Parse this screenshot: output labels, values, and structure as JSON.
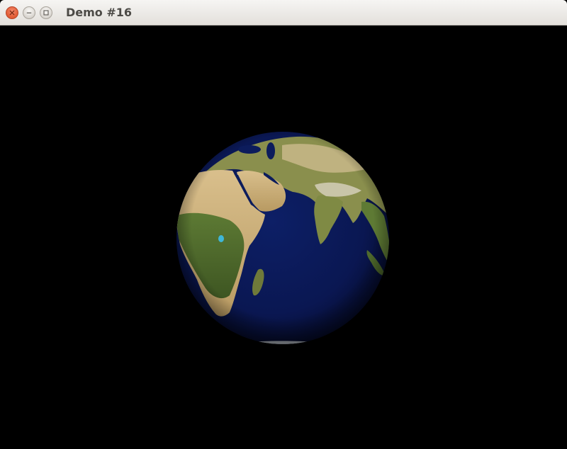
{
  "window": {
    "title": "Demo #16"
  },
  "controls": [
    {
      "name": "close",
      "icon": "close-icon"
    },
    {
      "name": "minimize",
      "icon": "minimize-icon"
    },
    {
      "name": "maximize",
      "icon": "maximize-icon"
    }
  ],
  "scene": {
    "background": "#000000",
    "object": "earth-globe",
    "ocean_color": "#0b1a55",
    "land_colors": [
      "#c9a970",
      "#4f6a2c",
      "#e2cfa2"
    ]
  }
}
